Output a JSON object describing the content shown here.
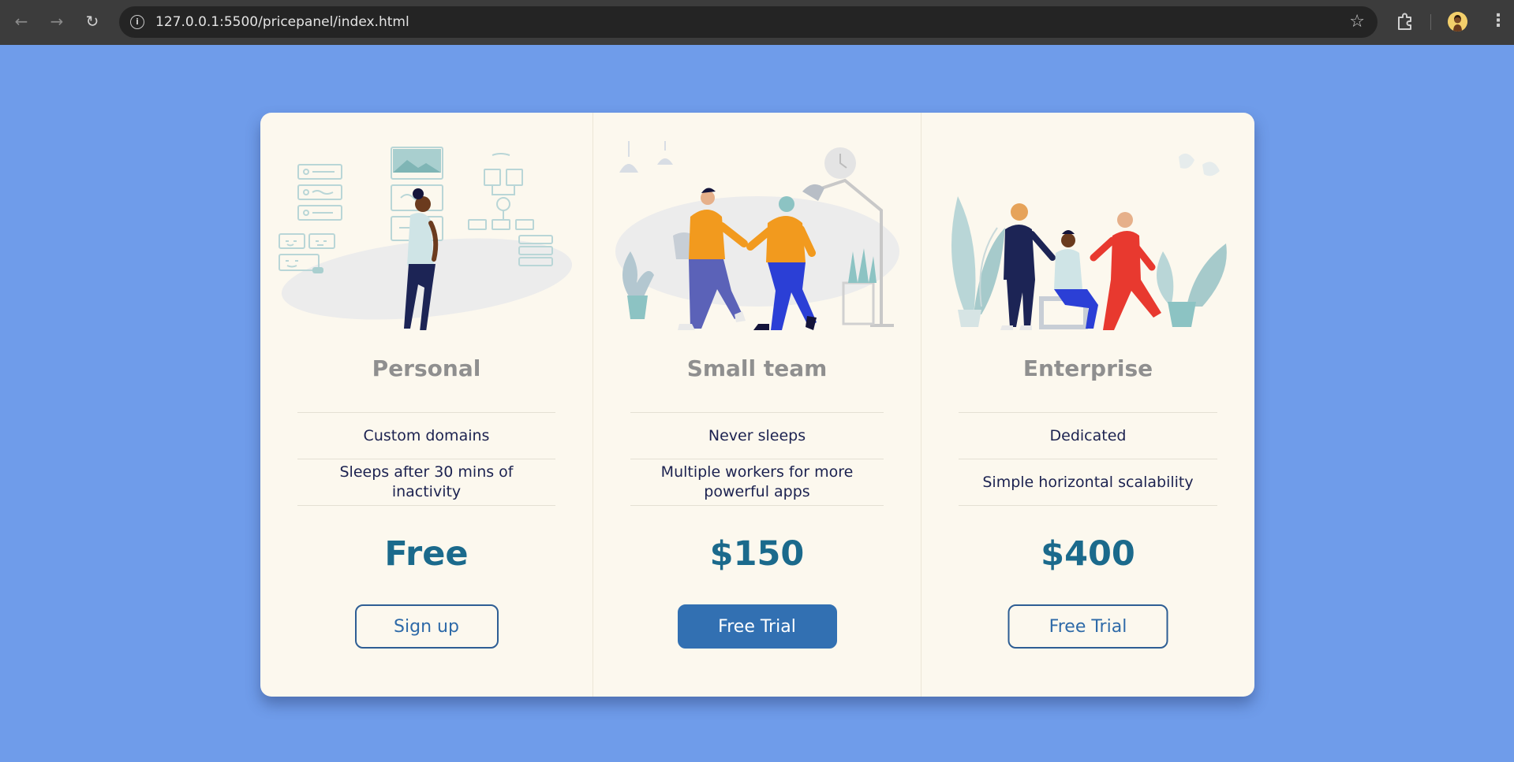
{
  "browser": {
    "url": "127.0.0.1:5500/pricepanel/index.html",
    "icons": [
      "back-arrow",
      "forward-arrow",
      "reload",
      "site-info",
      "bookmark-star",
      "extensions-puzzle",
      "profile-avatar",
      "kebab-menu"
    ]
  },
  "colors": {
    "page_background": "#6f9cea",
    "card_background": "#fcf8ee",
    "plan_title": "#8f8f8f",
    "feature_text": "#1c2250",
    "price": "#1b6a8c",
    "button_accent": "#3270b2"
  },
  "plans": [
    {
      "name": "Personal",
      "features": [
        "Custom domains",
        "Sleeps after 30 mins of inactivity"
      ],
      "price": "Free",
      "cta": "Sign up",
      "cta_style": "outline",
      "illustration": "person-walking-past-whiteboard"
    },
    {
      "name": "Small team",
      "features": [
        "Never sleeps",
        "Multiple workers for more powerful apps"
      ],
      "price": "$150",
      "cta": "Free Trial",
      "cta_style": "filled",
      "illustration": "two-people-walking"
    },
    {
      "name": "Enterprise",
      "features": [
        "Dedicated",
        "Simple horizontal scalability"
      ],
      "price": "$400",
      "cta": "Free Trial",
      "cta_style": "outline",
      "illustration": "team-meeting-with-plants"
    }
  ]
}
